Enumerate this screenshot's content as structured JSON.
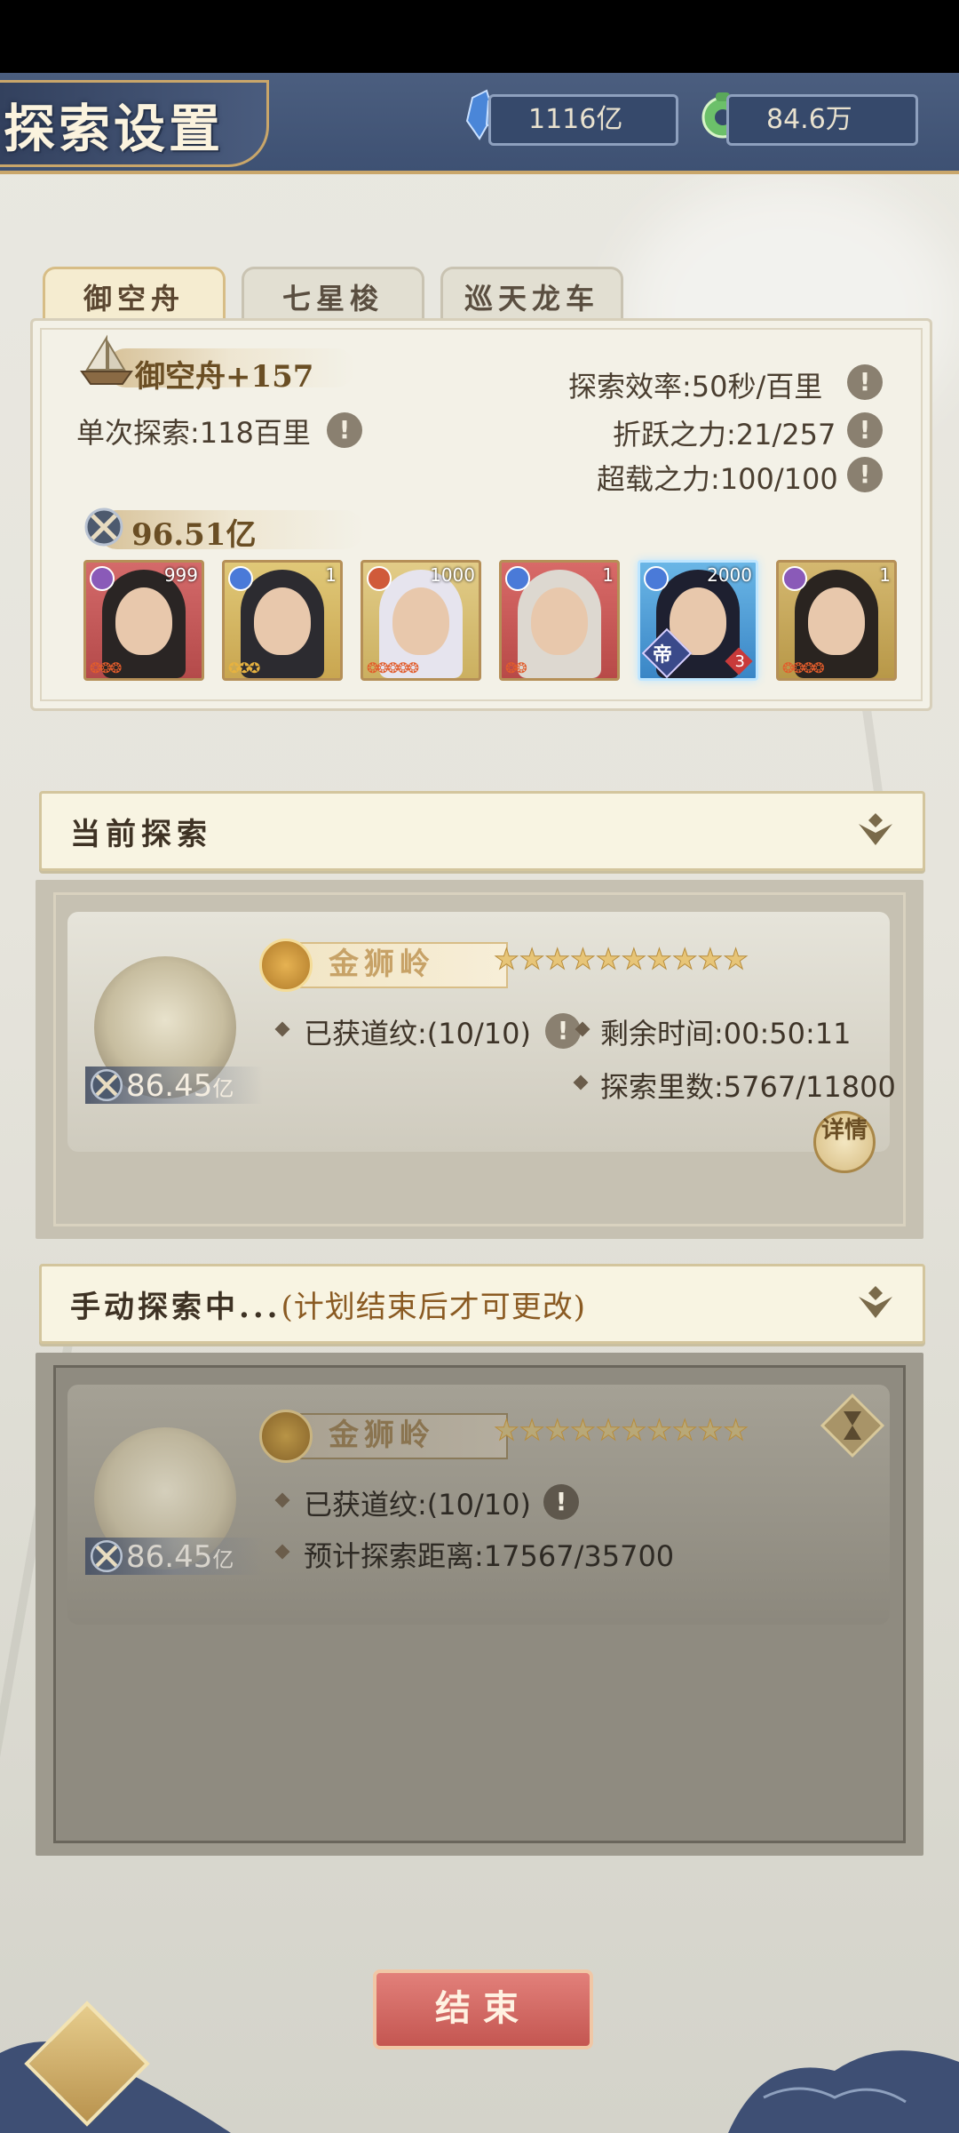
{
  "header": {
    "title": "探索设置"
  },
  "resources": [
    {
      "name": "crystal",
      "icon": "blue-crystal-icon",
      "value": "1116亿"
    },
    {
      "name": "jade",
      "icon": "jade-coin-icon",
      "value": "84.6万"
    }
  ],
  "tabs": [
    {
      "label": "御空舟",
      "active": true
    },
    {
      "label": "七星梭",
      "active": false
    },
    {
      "label": "巡天龙车",
      "active": false
    }
  ],
  "vehicle": {
    "name": "御空舟+157",
    "single_explore": "单次探索:118百里",
    "efficiency": "探索效率:50秒/百里",
    "fold_power": "折跃之力:21/257",
    "overload_power": "超载之力:100/100",
    "total_power": "96.51亿"
  },
  "heroes": [
    {
      "level": "999",
      "element": "purple",
      "stars": "❂❂❂"
    },
    {
      "level": "1",
      "element": "blue",
      "stars": "✪✪✪"
    },
    {
      "level": "1000",
      "element": "red",
      "stars": "❂❂❂❂❂"
    },
    {
      "level": "1",
      "element": "blue",
      "stars": "❂❂"
    },
    {
      "level": "2000",
      "element": "blue",
      "stars": "",
      "badge": "帝",
      "badge_count": "3"
    },
    {
      "level": "1",
      "element": "purple",
      "stars": "❂❂❂❂"
    }
  ],
  "current_explore": {
    "section_title": "当前探索",
    "location": "金狮岭",
    "stars": "★★★★★★★★★★",
    "dao_marks": "已获道纹:(10/10)",
    "remaining_time": "剩余时间:00:50:11",
    "distance": "探索里数:5767/11800",
    "power": "86.45",
    "power_unit": "亿",
    "detail_button": "详情"
  },
  "manual_explore": {
    "section_title_main": "手动探索中...",
    "section_title_note": "(计划结束后才可更改)",
    "location": "金狮岭",
    "stars": "★★★★★★★★★★",
    "dao_marks": "已获道纹:(10/10)",
    "expected_distance": "预计探索距离:17567/35700",
    "power": "86.45",
    "power_unit": "亿"
  },
  "end_button": "结束",
  "colors": {
    "header": "#44587a",
    "accent_gold": "#c9a66a",
    "end_button": "#cf625c"
  }
}
